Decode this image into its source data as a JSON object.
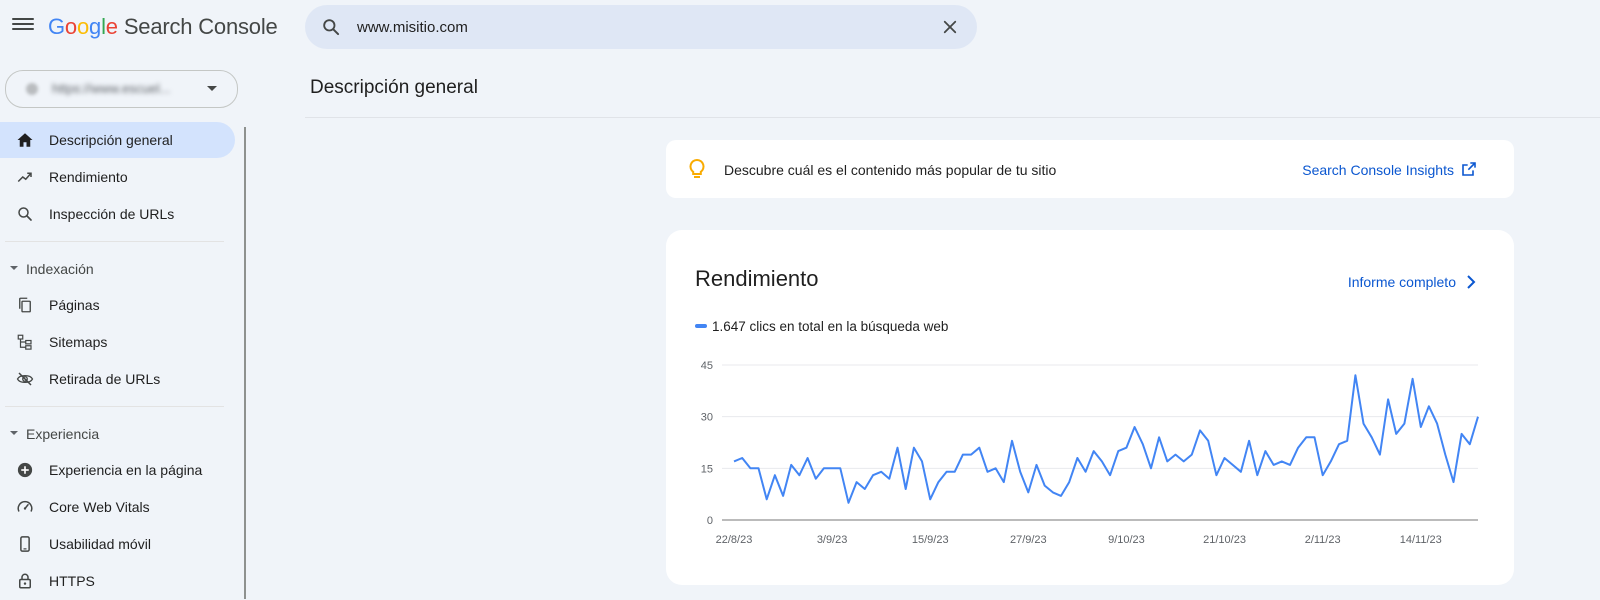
{
  "app": {
    "logo_letters": [
      "G",
      "o",
      "o",
      "g",
      "l",
      "e"
    ],
    "product": "Search Console"
  },
  "search": {
    "value": "www.misitio.com"
  },
  "property_selector": {
    "text": "https://www.escuel..."
  },
  "sidebar": {
    "top_items": [
      {
        "label": "Descripción general",
        "icon": "home-icon",
        "active": true
      },
      {
        "label": "Rendimiento",
        "icon": "trending-up-icon",
        "active": false
      },
      {
        "label": "Inspección de URLs",
        "icon": "search-icon",
        "active": false
      }
    ],
    "sections": [
      {
        "label": "Indexación",
        "items": [
          {
            "label": "Páginas",
            "icon": "pages-icon"
          },
          {
            "label": "Sitemaps",
            "icon": "sitemap-icon"
          },
          {
            "label": "Retirada de URLs",
            "icon": "visibility-off-icon"
          }
        ]
      },
      {
        "label": "Experiencia",
        "items": [
          {
            "label": "Experiencia en la página",
            "icon": "add-circle-icon"
          },
          {
            "label": "Core Web Vitals",
            "icon": "speed-gauge-icon"
          },
          {
            "label": "Usabilidad móvil",
            "icon": "smartphone-icon"
          },
          {
            "label": "HTTPS",
            "icon": "lock-icon"
          }
        ]
      }
    ]
  },
  "main": {
    "page_title": "Descripción general",
    "insight": {
      "text": "Descubre cuál es el contenido más popular de tu sitio",
      "link": "Search Console Insights"
    },
    "performance": {
      "title": "Rendimiento",
      "link": "Informe completo",
      "legend": "1.647 clics en total en la búsqueda web"
    }
  },
  "colors": {
    "accent": "#0b57d0",
    "series": "#4285f4",
    "active_nav": "#d3e3fd",
    "bulb": "#f9ab00"
  },
  "chart_data": {
    "type": "line",
    "series": [
      {
        "values": [
          17,
          18,
          15,
          15,
          6,
          13,
          7,
          16,
          13,
          18,
          12,
          15,
          15,
          15,
          5,
          11,
          9,
          13,
          14,
          12,
          21,
          9,
          21,
          17,
          6,
          11,
          14,
          14,
          19,
          19,
          21,
          14,
          15,
          11,
          23,
          14,
          8,
          16,
          10,
          8,
          7,
          11,
          18,
          14,
          20,
          17,
          13,
          20,
          21,
          27,
          22,
          15,
          24,
          17,
          19,
          17,
          19,
          26,
          23,
          13,
          18,
          16,
          14,
          23,
          13,
          20,
          16,
          17,
          16,
          21,
          24,
          24,
          13,
          17,
          22,
          23,
          42,
          28,
          24,
          19,
          35,
          25,
          28,
          41,
          27,
          33,
          28,
          19,
          11,
          25,
          22,
          30
        ]
      }
    ],
    "x_start": "22/8/23",
    "x_end": "21/11/23",
    "x_ticks": [
      "22/8/23",
      "3/9/23",
      "15/9/23",
      "27/9/23",
      "9/10/23",
      "21/10/23",
      "2/11/23",
      "14/11/23"
    ],
    "y_ticks": [
      "0",
      "15",
      "30",
      "45"
    ],
    "ylim": [
      0,
      45
    ],
    "grid": true
  }
}
